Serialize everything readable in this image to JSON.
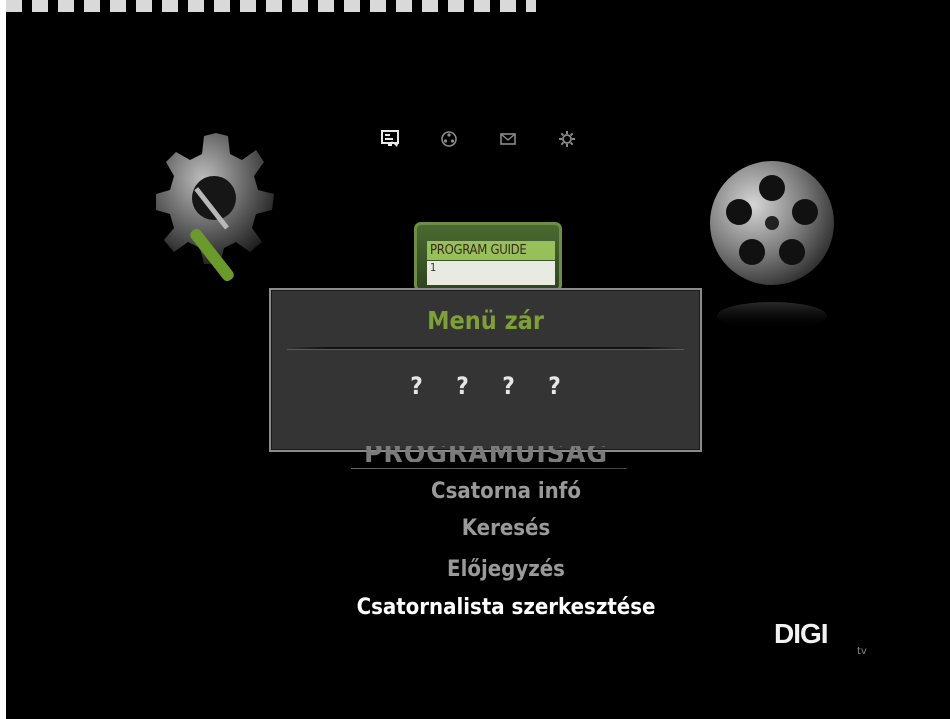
{
  "top_icons": [
    {
      "name": "tv-guide-icon",
      "color": "#e8e8e8"
    },
    {
      "name": "film-reel-icon",
      "color": "#8a8a8a"
    },
    {
      "name": "mail-icon",
      "color": "#8a8a8a"
    },
    {
      "name": "settings-gear-icon",
      "color": "#8a8a8a"
    }
  ],
  "program_guide": {
    "title": "PROGRAM GUIDE",
    "channel": "1"
  },
  "dialog": {
    "title": "Menü zár",
    "pin": [
      "?",
      "?",
      "?",
      "?"
    ]
  },
  "menu": {
    "header": "PROGRAMÚJSÁG",
    "items": [
      {
        "label": "Csatorna infó",
        "active": false
      },
      {
        "label": "Keresés",
        "active": false
      },
      {
        "label": "Előjegyzés",
        "active": false
      },
      {
        "label": "Csatornalista szerkesztése",
        "active": true
      }
    ]
  },
  "brand": {
    "logo": "DIGI",
    "suffix": "tv"
  },
  "colors": {
    "accent_green": "#7ea036",
    "background": "#000000",
    "dialog_bg": "#343434"
  }
}
